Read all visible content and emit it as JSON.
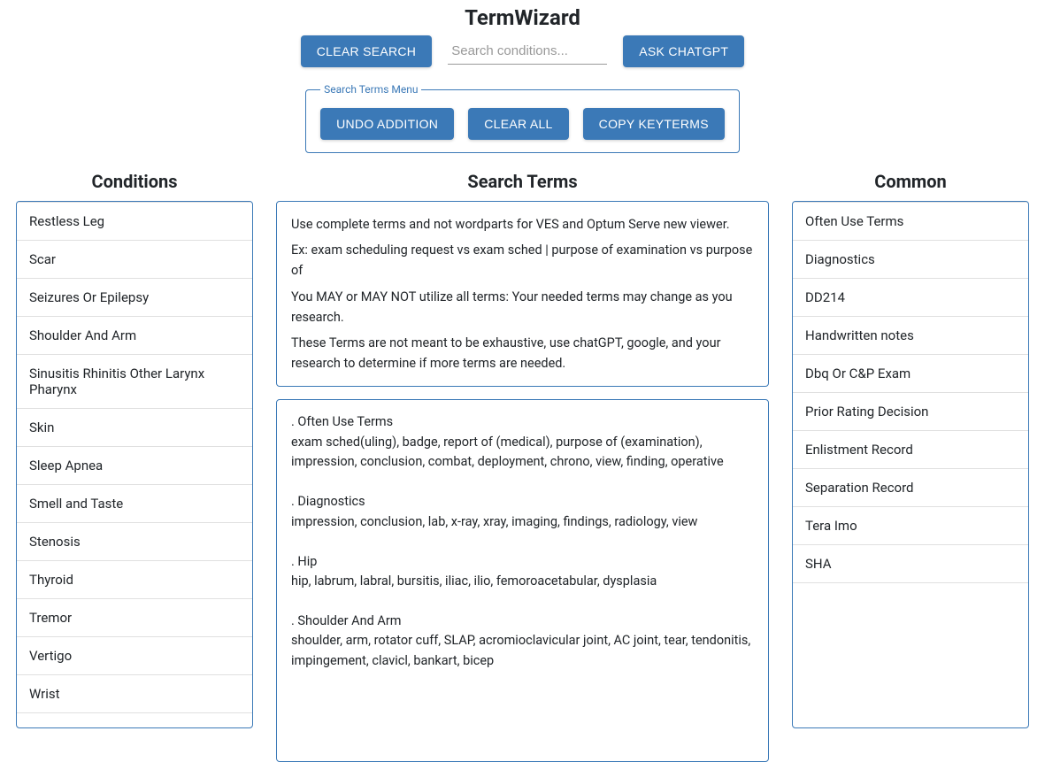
{
  "app_title": "TermWizard",
  "top": {
    "clear_search_label": "CLEAR SEARCH",
    "search_placeholder": "Search conditions...",
    "ask_chatgpt_label": "ASK CHATGPT"
  },
  "search_menu": {
    "legend": "Search Terms Menu",
    "undo_label": "UNDO ADDITION",
    "clear_all_label": "CLEAR ALL",
    "copy_label": "COPY KEYTERMS"
  },
  "headings": {
    "conditions": "Conditions",
    "search_terms": "Search Terms",
    "common": "Common"
  },
  "conditions": [
    "Restless Leg",
    "Scar",
    "Seizures Or Epilepsy",
    "Shoulder And Arm",
    "Sinusitis Rhinitis Other Larynx Pharynx",
    "Skin",
    "Sleep Apnea",
    "Smell and Taste",
    "Stenosis",
    "Thyroid",
    "Tremor",
    "Vertigo",
    "Wrist"
  ],
  "instructions": [
    "Use complete terms and not wordparts for VES and Optum Serve new viewer.",
    "Ex: exam scheduling request vs exam sched | purpose of examination vs purpose of",
    "You MAY or MAY NOT utilize all terms: Your needed terms may change as you research.",
    "These Terms are not meant to be exhaustive, use chatGPT, google, and your research to determine if more terms are needed."
  ],
  "terms_output": ". Often Use Terms\nexam sched(uling), badge, report of (medical), purpose of (examination), impression, conclusion, combat, deployment, chrono, view, finding, operative\n\n. Diagnostics\nimpression, conclusion, lab, x-ray, xray, imaging, findings, radiology, view\n\n. Hip\nhip, labrum, labral, bursitis, iliac, ilio, femoroacetabular, dysplasia\n\n. Shoulder And Arm\nshoulder, arm, rotator cuff, SLAP, acromioclavicular joint, AC joint, tear, tendonitis, impingement, clavicl, bankart, bicep",
  "common": [
    "Often Use Terms",
    "Diagnostics",
    "DD214",
    "Handwritten notes",
    "Dbq Or C&P Exam",
    "Prior Rating Decision",
    "Enlistment Record",
    "Separation Record",
    "Tera Imo",
    "SHA"
  ]
}
